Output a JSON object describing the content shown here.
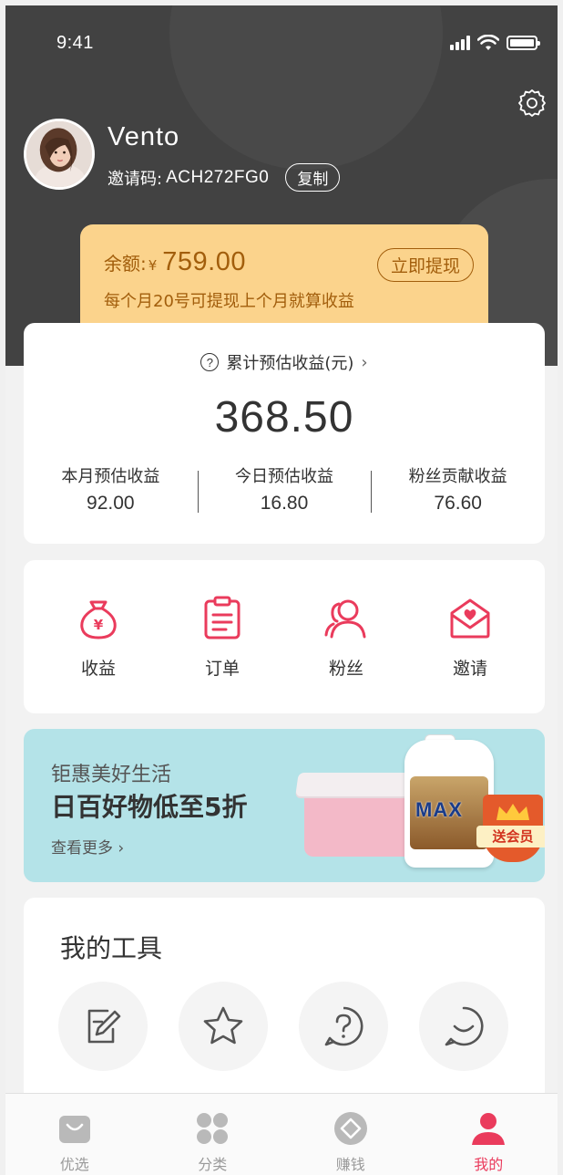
{
  "status_bar": {
    "time": "9:41"
  },
  "profile": {
    "username": "Vento",
    "invite_label": "邀请码:",
    "invite_code": "ACH272FG0",
    "copy_label": "复制"
  },
  "balance": {
    "label": "余额:",
    "currency": "¥",
    "amount": "759.00",
    "withdraw_label": "立即提现",
    "note": "每个月20号可提现上个月就算收益"
  },
  "earnings": {
    "title": "累计预估收益(元)",
    "total": "368.50",
    "stats": [
      {
        "label": "本月预估收益",
        "value": "92.00"
      },
      {
        "label": "今日预估收益",
        "value": "16.80"
      },
      {
        "label": "粉丝贡献收益",
        "value": "76.60"
      }
    ]
  },
  "menu": [
    {
      "label": "收益",
      "icon": "money-bag-icon"
    },
    {
      "label": "订单",
      "icon": "clipboard-icon"
    },
    {
      "label": "粉丝",
      "icon": "users-icon"
    },
    {
      "label": "邀请",
      "icon": "invite-envelope-icon"
    }
  ],
  "banner": {
    "subtitle": "钜惠美好生活",
    "title": "日百好物低至5折",
    "more_label": "查看更多",
    "product_text": "MAX",
    "badge_text": "送会员"
  },
  "tools": {
    "title": "我的工具",
    "items": [
      "edit-note-icon",
      "star-icon",
      "help-icon",
      "chat-smile-icon"
    ]
  },
  "tabbar": {
    "tabs": [
      {
        "label": "优选",
        "icon": "shopping-bag-icon",
        "active": false
      },
      {
        "label": "分类",
        "icon": "category-grid-icon",
        "active": false
      },
      {
        "label": "赚钱",
        "icon": "diamond-coin-icon",
        "active": false
      },
      {
        "label": "我的",
        "icon": "user-icon",
        "active": true
      }
    ]
  },
  "colors": {
    "accent": "#ea3b5c",
    "header_bg": "#424242",
    "balance_bg": "#fbd38c",
    "balance_text": "#a25e0c",
    "banner_bg": "#b4e3e8"
  }
}
